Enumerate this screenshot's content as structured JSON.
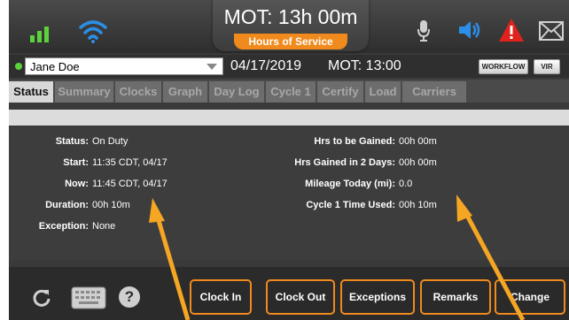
{
  "header": {
    "mot_title": "MOT: 13h 00m",
    "hos_label": "Hours of Service"
  },
  "icons": {
    "signal": "signal-bars-icon",
    "wifi": "wifi-icon",
    "mic": "microphone-icon",
    "speaker": "speaker-icon",
    "alert": "alert-triangle-icon",
    "mail": "mail-icon"
  },
  "colors": {
    "accent": "#f08a1c",
    "wifi_blue": "#2b8fe8",
    "alert_red": "#e0221c",
    "online_green": "#5bd23c"
  },
  "driver": {
    "name": "Jane Doe",
    "date": "04/17/2019",
    "mot": "MOT: 13:00"
  },
  "buttons": {
    "workflow": "WORKFLOW",
    "vir": "VIR"
  },
  "tabs": [
    "Status",
    "Summary",
    "Clocks",
    "Graph",
    "Day Log",
    "Cycle 1",
    "Certify",
    "Load",
    "Carriers"
  ],
  "status": {
    "left": [
      {
        "label": "Status:",
        "value": "On Duty"
      },
      {
        "label": "Start:",
        "value": "11:35 CDT, 04/17"
      },
      {
        "label": "Now:",
        "value": "11:45 CDT, 04/17"
      },
      {
        "label": "Duration:",
        "value": "00h 10m"
      },
      {
        "label": "Exception:",
        "value": "None"
      }
    ],
    "right": [
      {
        "label": "Hrs to be Gained:",
        "value": "00h 00m"
      },
      {
        "label": "Hrs Gained in 2 Days:",
        "value": "00h 00m"
      },
      {
        "label": "Mileage Today (mi):",
        "value": "0.0"
      },
      {
        "label": "Cycle 1 Time Used:",
        "value": "00h 10m"
      }
    ]
  },
  "bottom": {
    "help": "?",
    "actions": [
      "Clock In",
      "Clock Out",
      "Exceptions",
      "Remarks",
      "Change"
    ]
  }
}
